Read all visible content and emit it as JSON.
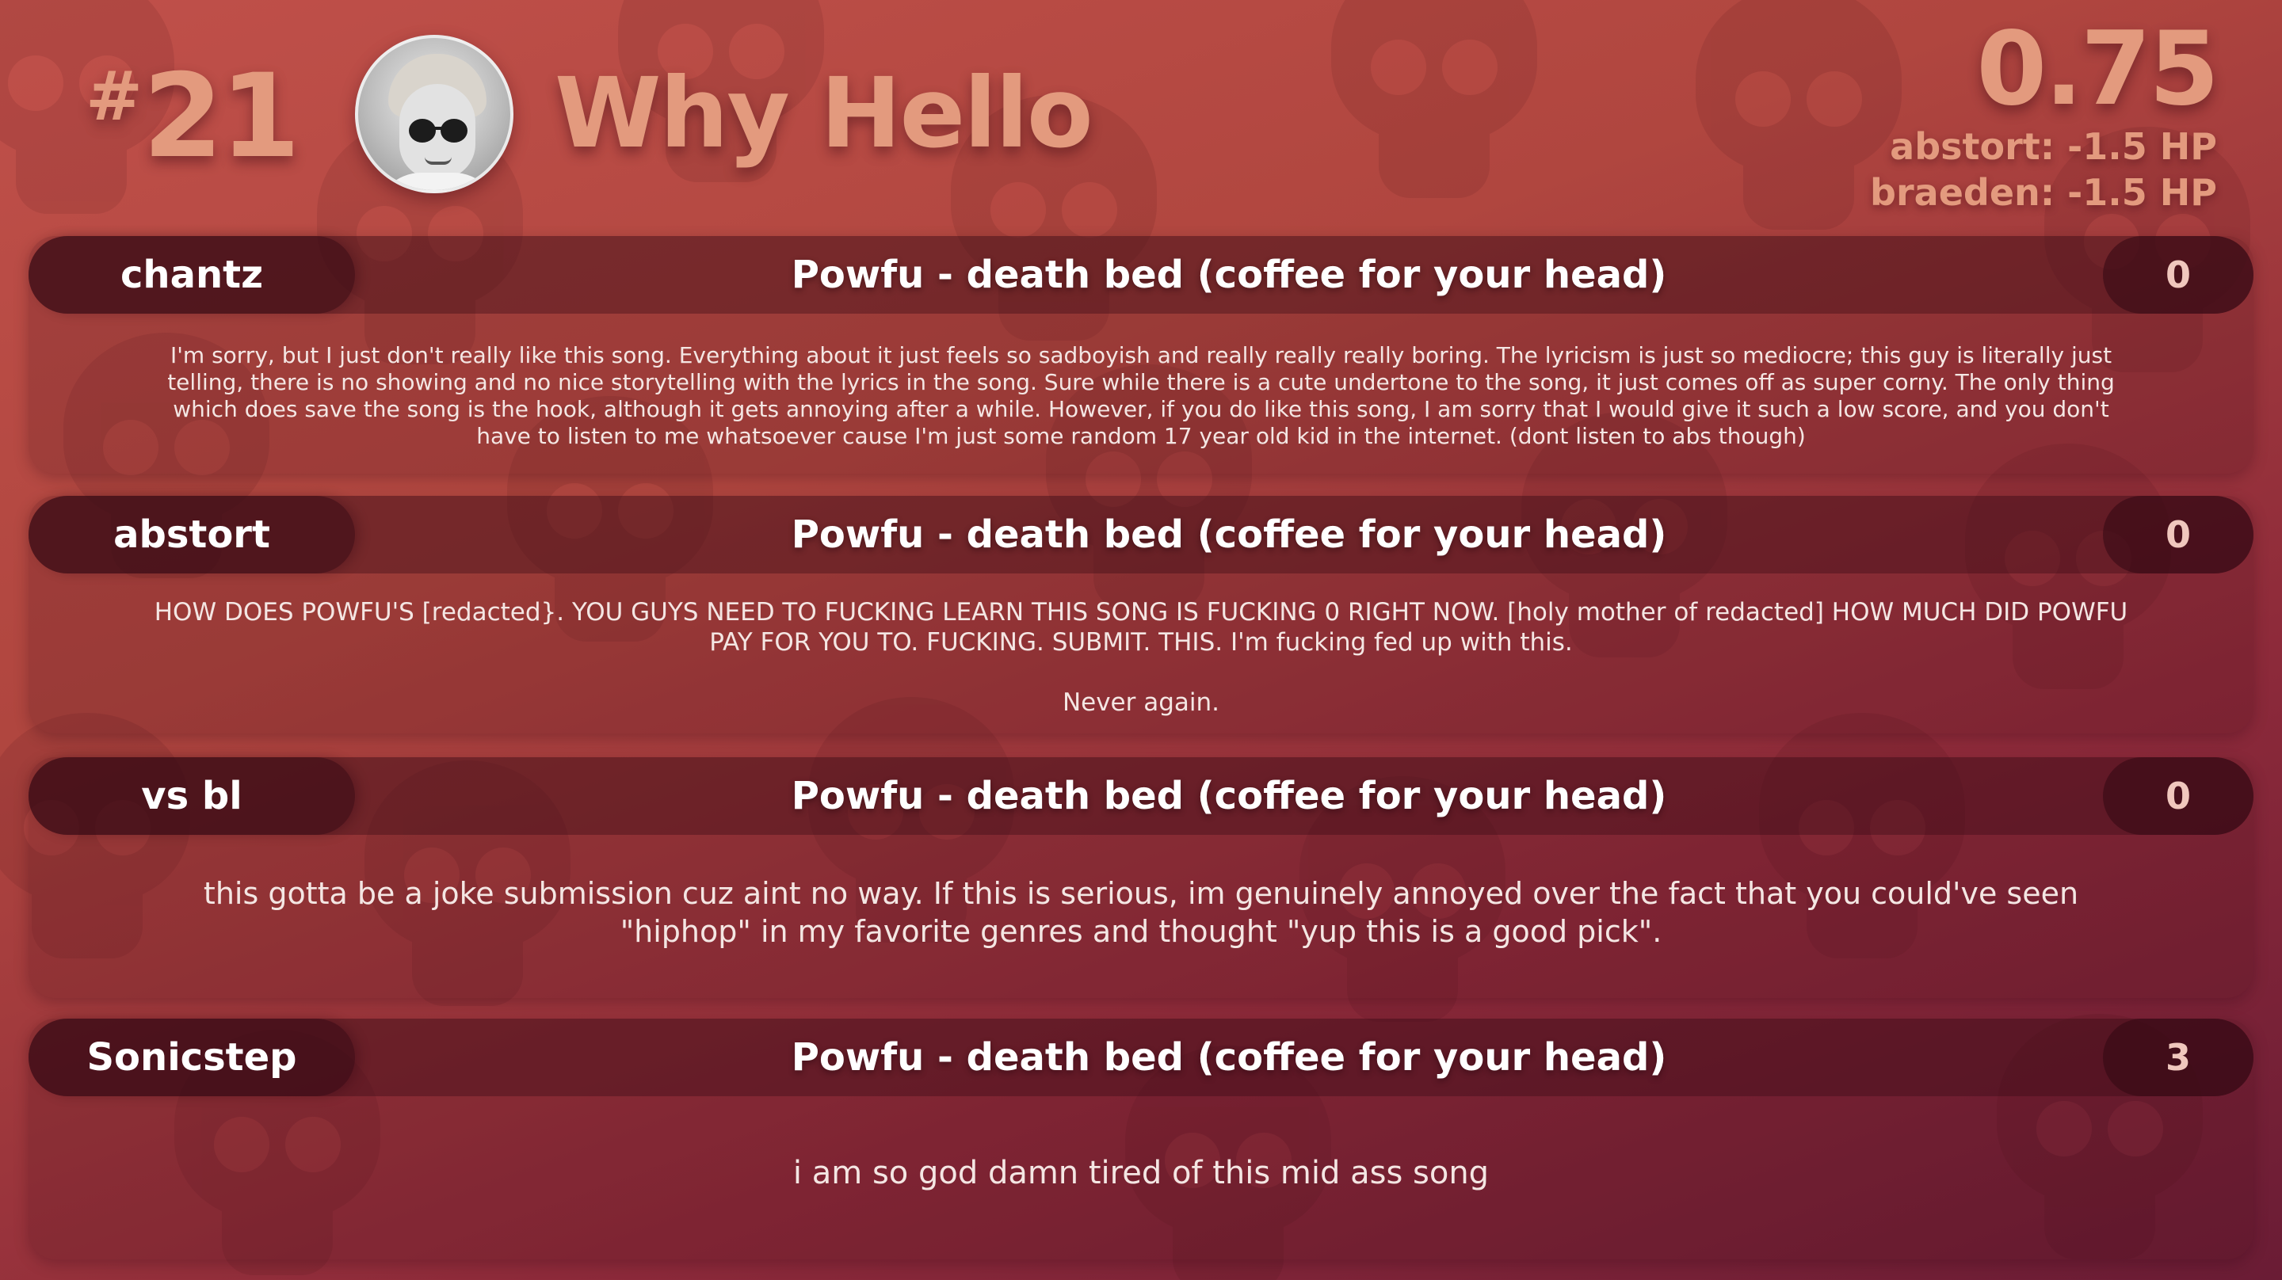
{
  "header": {
    "rank_hash": "#",
    "rank_number": "21",
    "title": "Why Hello",
    "score": "0.75",
    "penalties": [
      "abstort: -1.5 HP",
      "braeden: -1.5 HP"
    ]
  },
  "colors": {
    "accent": "#e39a7e",
    "background_top": "#c0504a",
    "background_bottom": "#6a1c35"
  },
  "icons": {
    "background": "skull-pattern-icon",
    "avatar": "user-avatar"
  },
  "reviews": [
    {
      "reviewer": "chantz",
      "song": "Powfu - death bed (coffee for your head)",
      "rating": "0",
      "text": "I'm sorry, but I just don't really like this song. Everything about it just feels so sadboyish and really really really boring. The lyricism is just so mediocre; this guy is literally just telling, there is no showing and no nice storytelling with the lyrics in the song. Sure while there is a cute undertone to the song, it just comes off as super corny. The only thing which does save the song is the hook, although it gets annoying after a while. However, if you do like this song, I am sorry that I would give it such a low score, and you don't have to listen to me whatsoever cause I'm just some random 17 year old kid in the internet. (dont listen to abs though)"
    },
    {
      "reviewer": "abstort",
      "song": "Powfu - death bed (coffee for your head)",
      "rating": "0",
      "text": "HOW DOES POWFU'S [redacted}. YOU GUYS NEED TO FUCKING LEARN THIS SONG IS FUCKING 0 RIGHT NOW. [holy mother of redacted] HOW MUCH DID POWFU PAY FOR YOU TO. FUCKING. SUBMIT. THIS. I'm fucking fed up with this.\n\nNever again."
    },
    {
      "reviewer": "vs bl",
      "song": "Powfu - death bed (coffee for your head)",
      "rating": "0",
      "text": "this gotta be a joke submission cuz aint no way. If this is serious, im genuinely annoyed over the fact that you could've seen \"hiphop\" in my favorite genres and thought \"yup this is a good pick\"."
    },
    {
      "reviewer": "Sonicstep",
      "song": "Powfu - death bed (coffee for your head)",
      "rating": "3",
      "text": "i am so god damn tired of this mid ass song"
    }
  ]
}
